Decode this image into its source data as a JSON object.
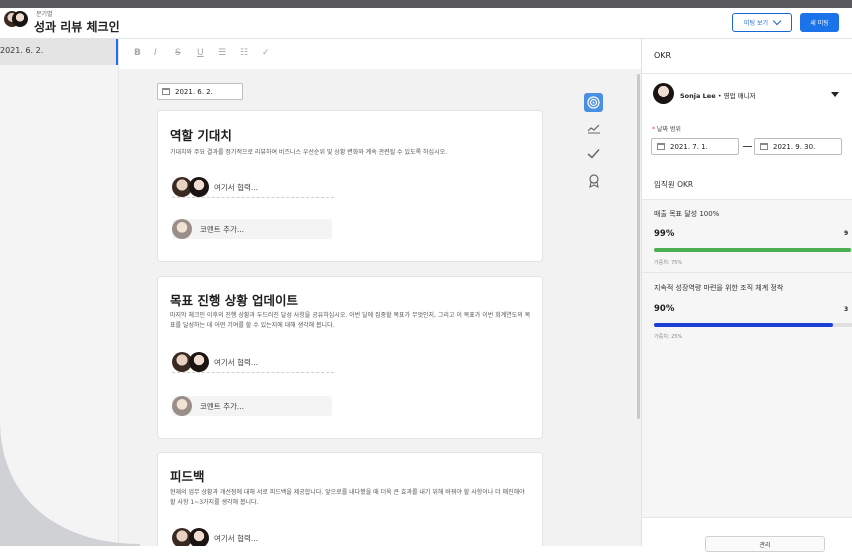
{
  "header": {
    "eyebrow": "분기별",
    "title": "성과 리뷰 체크인",
    "view_meeting_label": "미팅 보기",
    "new_meeting_label": "새 미팅"
  },
  "sidebar": {
    "items": [
      {
        "label": "2021. 6. 2."
      }
    ]
  },
  "toolbar": {
    "bold": "B",
    "italic": "I",
    "strike": "S",
    "underline": "U",
    "bullet_list": "☰",
    "number_list": "☷",
    "check": "✓"
  },
  "editor": {
    "date": "2021. 6. 2.",
    "sections": [
      {
        "title": "역할 기대치",
        "description": "기대치와 주요 결과를 정기적으로 리뷰하여 비즈니스 우선순위 및 상황 변화와 계속 관련될 수 있도록 하십시오.",
        "collab_label": "여기서 협력...",
        "comment_label": "코멘트 추가..."
      },
      {
        "title": "목표 진행 상황 업데이트",
        "description": "마지막 체크인 이후의 진행 상황과 두드러진 달성 사항을 공유하십시오. 이번 달에 집중할 목표가 무엇인지, 그리고 이 목표가 이번 회계연도의 목표를 달성하는 데 어떤 기여를 할 수 있는지에 대해 생각해 봅니다.",
        "collab_label": "여기서 협력...",
        "comment_label": "코멘트 추가..."
      },
      {
        "title": "피드백",
        "description": "현재의 업무 상황과 개선점에 대해 서로 피드백을 제공합니다. 앞으로를 내다봤을 때 더욱 큰 효과를 내기 위해 바꿔야 할 사항이나 더 매진해야 할 사항 1~3가지를 생각해 봅니다.",
        "collab_label": "여기서 협력..."
      }
    ]
  },
  "okr_panel": {
    "title": "OKR",
    "user_name": "Sonja Lee",
    "user_role": " • 영업 매니저",
    "date_range_label": "날짜 범위",
    "date_from": "2021. 7. 1.",
    "date_to": "2021. 9. 30.",
    "section_title": "임직원 OKR",
    "objectives": [
      {
        "name": "매출 목표 달성 100%",
        "percent_label": "99%",
        "progress": 0.99,
        "edge_value": "9",
        "weight_label": "가중치: 75%",
        "color": "#4caf50"
      },
      {
        "name": "지속적 성장역량 마련을 위한 조직 체계 정착",
        "percent_label": "90%",
        "progress": 0.9,
        "edge_value": "3",
        "weight_label": "가중치: 25%",
        "color": "#1a3fd6"
      }
    ],
    "manage_label": "관리"
  },
  "colors": {
    "accent": "#1a73e8",
    "progress_green": "#4caf50",
    "progress_blue": "#1a3fd6"
  },
  "icons": {
    "side_tools": [
      "target-icon",
      "trend-chart-icon",
      "check-icon",
      "award-icon"
    ]
  }
}
